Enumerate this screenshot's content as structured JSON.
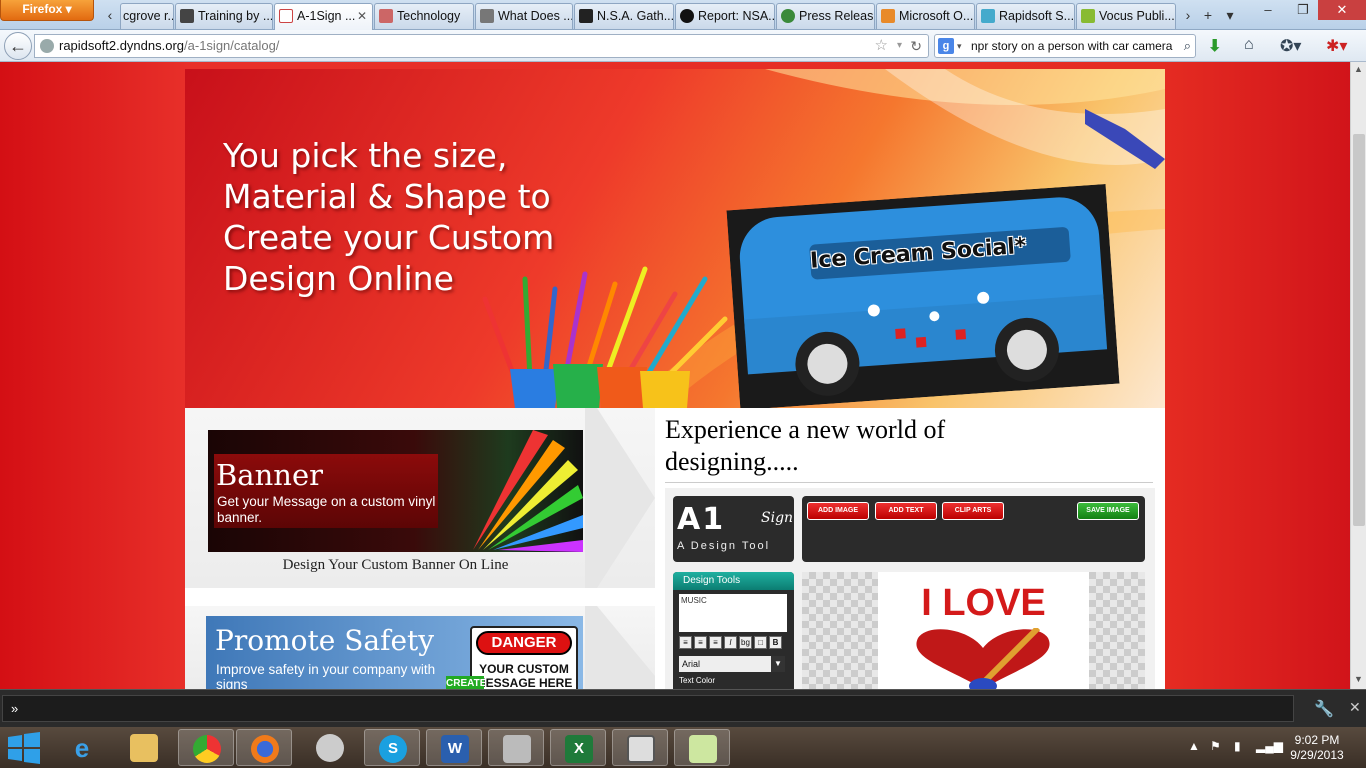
{
  "browser": {
    "app_button": "Firefox",
    "tabs": [
      {
        "label": "cgrove r...",
        "icon": "page-icon",
        "active": false
      },
      {
        "label": "Training by ...",
        "icon": "training-icon",
        "active": false
      },
      {
        "label": "A-1Sign ...",
        "icon": "a1sign-icon",
        "active": true
      },
      {
        "label": "Technology",
        "icon": "tech-icon",
        "active": false
      },
      {
        "label": "What Does ...",
        "icon": "wsj-icon",
        "active": false
      },
      {
        "label": "N.S.A. Gath...",
        "icon": "nyt-icon",
        "active": false
      },
      {
        "label": "Report: NSA...",
        "icon": "abc-icon",
        "active": false
      },
      {
        "label": "Press Releas...",
        "icon": "press-icon",
        "active": false
      },
      {
        "label": "Microsoft O...",
        "icon": "microsoft-icon",
        "active": false
      },
      {
        "label": "Rapidsoft S...",
        "icon": "rapidsoft-icon",
        "active": false
      },
      {
        "label": "Vocus Publi...",
        "icon": "vocus-icon",
        "active": false
      }
    ],
    "url_host": "rapidsoft2.dyndns.org",
    "url_path": "/a-1sign/catalog/",
    "search_value": "npr story on a person with car camera",
    "search_engine_icon": "google-icon"
  },
  "hero": {
    "headline_lines": [
      "You pick the size,",
      "Material & Shape to",
      "Create your Custom",
      "Design Online"
    ],
    "bus_sign": "Ice Cream Social*"
  },
  "promos": {
    "banner": {
      "title": "Banner",
      "subtitle": "Get your Message on a custom vinyl  banner.",
      "caption": "Design Your Custom Banner On Line"
    },
    "safety": {
      "title": "Promote Safety",
      "subtitle": "Improve safety in your company with signs",
      "danger_label": "DANGER",
      "danger_body": "YOUR CUSTOM MESSAGE HERE",
      "create_label": "CREATE"
    }
  },
  "experience": {
    "heading": "Experience a new world of designing....."
  },
  "design_tool": {
    "logo_main": "A1",
    "logo_sign": "Sign",
    "logo_sub": "A Design Tool",
    "buttons": [
      "ADD IMAGE",
      "ADD TEXT",
      "CLIP ARTS"
    ],
    "save_button": "SAVE IMAGE",
    "panel_title": "Design Tools",
    "text_value": "MUSIC",
    "format_buttons": [
      "≡",
      "≡",
      "≡",
      "I",
      "bg",
      "□",
      "B"
    ],
    "font_value": "Arial",
    "text_color_label": "Text Color",
    "canvas_text": "I LOVE"
  },
  "findbar": {
    "value": "»"
  },
  "taskbar": {
    "apps": [
      "ie-icon",
      "explorer-icon",
      "chrome-icon",
      "firefox-icon",
      "paint-icon",
      "skype-icon",
      "word-icon",
      "scanner-icon",
      "excel-icon",
      "viewer-icon",
      "notepad-icon"
    ],
    "time": "9:02 PM",
    "date": "9/29/2013"
  }
}
